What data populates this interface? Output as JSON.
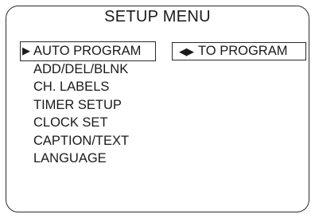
{
  "title": "SETUP MENU",
  "pointer_glyph": "▶",
  "menu": {
    "items": [
      {
        "label": "AUTO PROGRAM"
      },
      {
        "label": "ADD/DEL/BLNK"
      },
      {
        "label": "CH. LABELS"
      },
      {
        "label": "TIMER SETUP"
      },
      {
        "label": "CLOCK SET"
      },
      {
        "label": "CAPTION/TEXT"
      },
      {
        "label": "LANGUAGE"
      }
    ]
  },
  "hint": {
    "arrows": "◀▶",
    "text": "TO PROGRAM"
  }
}
